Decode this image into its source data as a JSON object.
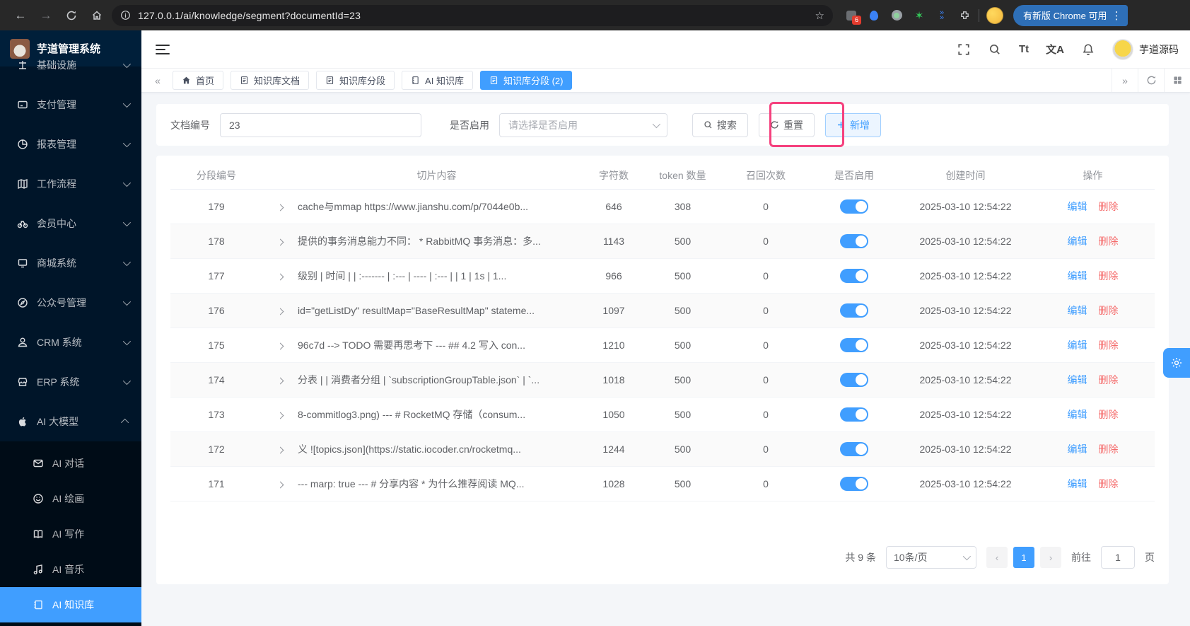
{
  "browser": {
    "url": "127.0.0.1/ai/knowledge/segment?documentId=23",
    "extension_badge": "6",
    "update_pill_label": "有新版 Chrome 可用"
  },
  "sidebar": {
    "logo_title": "芋道管理系统",
    "items": [
      {
        "label": "基础设施"
      },
      {
        "label": "支付管理"
      },
      {
        "label": "报表管理"
      },
      {
        "label": "工作流程"
      },
      {
        "label": "会员中心"
      },
      {
        "label": "商城系统"
      },
      {
        "label": "公众号管理"
      },
      {
        "label": "CRM 系统"
      },
      {
        "label": "ERP 系统"
      },
      {
        "label": "AI 大模型"
      }
    ],
    "submenu": [
      {
        "label": "AI 对话"
      },
      {
        "label": "AI 绘画"
      },
      {
        "label": "AI 写作"
      },
      {
        "label": "AI 音乐"
      },
      {
        "label": "AI 知识库",
        "active": true
      }
    ]
  },
  "header": {
    "user_name": "芋道源码",
    "font_icon": "Tt",
    "translate_icon": "文A"
  },
  "tabs": [
    {
      "label": "首页"
    },
    {
      "label": "知识库文档"
    },
    {
      "label": "知识库分段"
    },
    {
      "label": "AI 知识库"
    },
    {
      "label": "知识库分段 (2)",
      "active": true
    }
  ],
  "filter": {
    "doc_label": "文档编号",
    "doc_value": "23",
    "enable_label": "是否启用",
    "enable_placeholder": "请选择是否启用",
    "search_label": "搜索",
    "reset_label": "重置",
    "add_label": "新增"
  },
  "table": {
    "headers": [
      "分段编号",
      "切片内容",
      "字符数",
      "token 数量",
      "召回次数",
      "是否启用",
      "创建时间",
      "操作"
    ],
    "actions": {
      "edit": "编辑",
      "delete": "删除"
    },
    "rows": [
      {
        "id": "179",
        "content": "cache与mmap https://www.jianshu.com/p/7044e0b...",
        "chars": "646",
        "tokens": "308",
        "recalls": "0",
        "enabled": true,
        "created": "2025-03-10 12:54:22"
      },
      {
        "id": "178",
        "content": "提供的事务消息能力不同： * RabbitMQ 事务消息：多...",
        "chars": "1143",
        "tokens": "500",
        "recalls": "0",
        "enabled": true,
        "created": "2025-03-10 12:54:22"
      },
      {
        "id": "177",
        "content": "级别 | 时间 | | :------- | :--- | ---- | :--- | | 1 | 1s | 1...",
        "chars": "966",
        "tokens": "500",
        "recalls": "0",
        "enabled": true,
        "created": "2025-03-10 12:54:22"
      },
      {
        "id": "176",
        "content": "id=\"getListDy\" resultMap=\"BaseResultMap\" stateme...",
        "chars": "1097",
        "tokens": "500",
        "recalls": "0",
        "enabled": true,
        "created": "2025-03-10 12:54:22"
      },
      {
        "id": "175",
        "content": "96c7d --> TODO 需要再思考下 --- ## 4.2 写入 con...",
        "chars": "1210",
        "tokens": "500",
        "recalls": "0",
        "enabled": true,
        "created": "2025-03-10 12:54:22"
      },
      {
        "id": "174",
        "content": "分表 | | 消费者分组 | `subscriptionGroupTable.json` | `...",
        "chars": "1018",
        "tokens": "500",
        "recalls": "0",
        "enabled": true,
        "created": "2025-03-10 12:54:22"
      },
      {
        "id": "173",
        "content": "8-commitlog3.png) --- # RocketMQ 存储（consum...",
        "chars": "1050",
        "tokens": "500",
        "recalls": "0",
        "enabled": true,
        "created": "2025-03-10 12:54:22"
      },
      {
        "id": "172",
        "content": "义 ![topics.json](https://static.iocoder.cn/rocketmq...",
        "chars": "1244",
        "tokens": "500",
        "recalls": "0",
        "enabled": true,
        "created": "2025-03-10 12:54:22"
      },
      {
        "id": "171",
        "content": "--- marp: true --- # 分享内容 * 为什么推荐阅读 MQ...",
        "chars": "1028",
        "tokens": "500",
        "recalls": "0",
        "enabled": true,
        "created": "2025-03-10 12:54:22"
      }
    ]
  },
  "pagination": {
    "total_label": "共 9 条",
    "page_size_label": "10条/页",
    "current_page": "1",
    "goto_label": "前往",
    "goto_value": "1",
    "page_suffix": "页"
  },
  "colors": {
    "accent": "#409eff",
    "danger": "#f56c6c",
    "annotation": "#f5407d",
    "sidebar": "#001529"
  }
}
